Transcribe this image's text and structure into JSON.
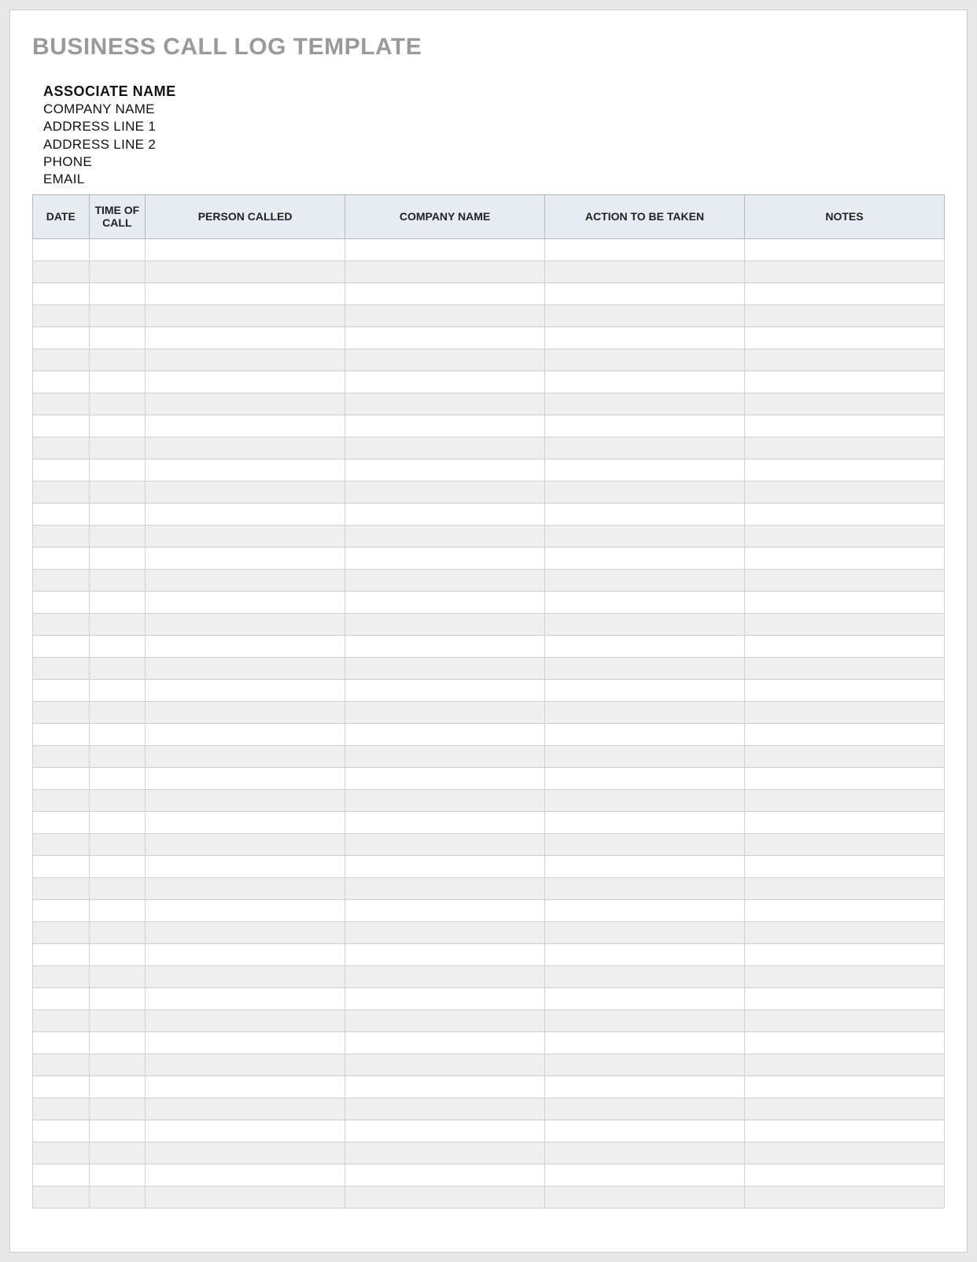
{
  "title": "BUSINESS CALL LOG TEMPLATE",
  "info": {
    "associate": "ASSOCIATE NAME",
    "company": "COMPANY NAME",
    "address1": "ADDRESS LINE 1",
    "address2": "ADDRESS LINE 2",
    "phone": "PHONE",
    "email": "EMAIL"
  },
  "columns": {
    "date": "DATE",
    "time": "TIME OF CALL",
    "person": "PERSON CALLED",
    "company": "COMPANY NAME",
    "action": "ACTION TO BE TAKEN",
    "notes": "NOTES"
  },
  "rows": [
    {
      "date": "",
      "time": "",
      "person": "",
      "company": "",
      "action": "",
      "notes": ""
    },
    {
      "date": "",
      "time": "",
      "person": "",
      "company": "",
      "action": "",
      "notes": ""
    },
    {
      "date": "",
      "time": "",
      "person": "",
      "company": "",
      "action": "",
      "notes": ""
    },
    {
      "date": "",
      "time": "",
      "person": "",
      "company": "",
      "action": "",
      "notes": ""
    },
    {
      "date": "",
      "time": "",
      "person": "",
      "company": "",
      "action": "",
      "notes": ""
    },
    {
      "date": "",
      "time": "",
      "person": "",
      "company": "",
      "action": "",
      "notes": ""
    },
    {
      "date": "",
      "time": "",
      "person": "",
      "company": "",
      "action": "",
      "notes": ""
    },
    {
      "date": "",
      "time": "",
      "person": "",
      "company": "",
      "action": "",
      "notes": ""
    },
    {
      "date": "",
      "time": "",
      "person": "",
      "company": "",
      "action": "",
      "notes": ""
    },
    {
      "date": "",
      "time": "",
      "person": "",
      "company": "",
      "action": "",
      "notes": ""
    },
    {
      "date": "",
      "time": "",
      "person": "",
      "company": "",
      "action": "",
      "notes": ""
    },
    {
      "date": "",
      "time": "",
      "person": "",
      "company": "",
      "action": "",
      "notes": ""
    },
    {
      "date": "",
      "time": "",
      "person": "",
      "company": "",
      "action": "",
      "notes": ""
    },
    {
      "date": "",
      "time": "",
      "person": "",
      "company": "",
      "action": "",
      "notes": ""
    },
    {
      "date": "",
      "time": "",
      "person": "",
      "company": "",
      "action": "",
      "notes": ""
    },
    {
      "date": "",
      "time": "",
      "person": "",
      "company": "",
      "action": "",
      "notes": ""
    },
    {
      "date": "",
      "time": "",
      "person": "",
      "company": "",
      "action": "",
      "notes": ""
    },
    {
      "date": "",
      "time": "",
      "person": "",
      "company": "",
      "action": "",
      "notes": ""
    },
    {
      "date": "",
      "time": "",
      "person": "",
      "company": "",
      "action": "",
      "notes": ""
    },
    {
      "date": "",
      "time": "",
      "person": "",
      "company": "",
      "action": "",
      "notes": ""
    },
    {
      "date": "",
      "time": "",
      "person": "",
      "company": "",
      "action": "",
      "notes": ""
    },
    {
      "date": "",
      "time": "",
      "person": "",
      "company": "",
      "action": "",
      "notes": ""
    },
    {
      "date": "",
      "time": "",
      "person": "",
      "company": "",
      "action": "",
      "notes": ""
    },
    {
      "date": "",
      "time": "",
      "person": "",
      "company": "",
      "action": "",
      "notes": ""
    },
    {
      "date": "",
      "time": "",
      "person": "",
      "company": "",
      "action": "",
      "notes": ""
    },
    {
      "date": "",
      "time": "",
      "person": "",
      "company": "",
      "action": "",
      "notes": ""
    },
    {
      "date": "",
      "time": "",
      "person": "",
      "company": "",
      "action": "",
      "notes": ""
    },
    {
      "date": "",
      "time": "",
      "person": "",
      "company": "",
      "action": "",
      "notes": ""
    },
    {
      "date": "",
      "time": "",
      "person": "",
      "company": "",
      "action": "",
      "notes": ""
    },
    {
      "date": "",
      "time": "",
      "person": "",
      "company": "",
      "action": "",
      "notes": ""
    },
    {
      "date": "",
      "time": "",
      "person": "",
      "company": "",
      "action": "",
      "notes": ""
    },
    {
      "date": "",
      "time": "",
      "person": "",
      "company": "",
      "action": "",
      "notes": ""
    },
    {
      "date": "",
      "time": "",
      "person": "",
      "company": "",
      "action": "",
      "notes": ""
    },
    {
      "date": "",
      "time": "",
      "person": "",
      "company": "",
      "action": "",
      "notes": ""
    },
    {
      "date": "",
      "time": "",
      "person": "",
      "company": "",
      "action": "",
      "notes": ""
    },
    {
      "date": "",
      "time": "",
      "person": "",
      "company": "",
      "action": "",
      "notes": ""
    },
    {
      "date": "",
      "time": "",
      "person": "",
      "company": "",
      "action": "",
      "notes": ""
    },
    {
      "date": "",
      "time": "",
      "person": "",
      "company": "",
      "action": "",
      "notes": ""
    },
    {
      "date": "",
      "time": "",
      "person": "",
      "company": "",
      "action": "",
      "notes": ""
    },
    {
      "date": "",
      "time": "",
      "person": "",
      "company": "",
      "action": "",
      "notes": ""
    },
    {
      "date": "",
      "time": "",
      "person": "",
      "company": "",
      "action": "",
      "notes": ""
    },
    {
      "date": "",
      "time": "",
      "person": "",
      "company": "",
      "action": "",
      "notes": ""
    },
    {
      "date": "",
      "time": "",
      "person": "",
      "company": "",
      "action": "",
      "notes": ""
    },
    {
      "date": "",
      "time": "",
      "person": "",
      "company": "",
      "action": "",
      "notes": ""
    }
  ]
}
